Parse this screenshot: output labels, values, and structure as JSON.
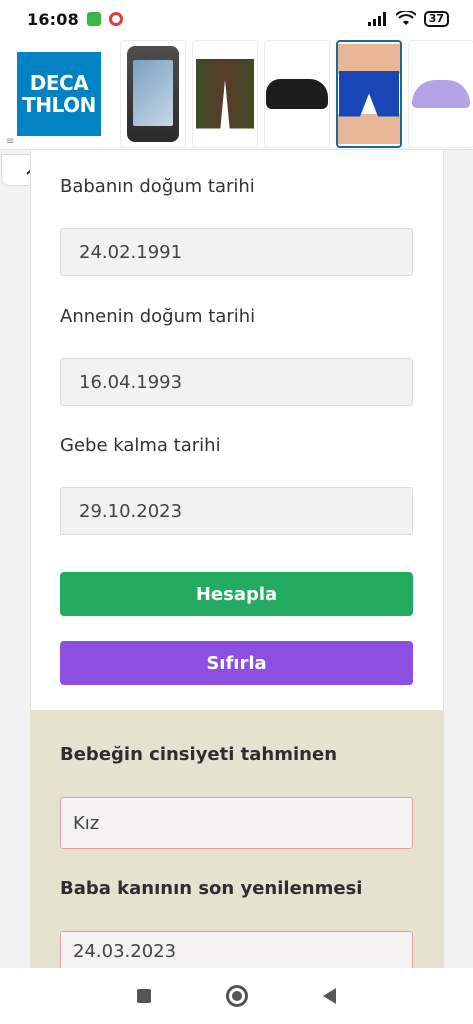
{
  "status_bar": {
    "time": "16:08",
    "battery": "37"
  },
  "ad": {
    "brand_line1": "DECA",
    "brand_line2": "THLON",
    "products": [
      "phone-pouch",
      "shorts",
      "water-shoe",
      "swim-trunks",
      "cap"
    ]
  },
  "form": {
    "father_label": "Babanın doğum tarihi",
    "father_value": "24.02.1991",
    "mother_label": "Annenin doğum tarihi",
    "mother_value": "16.04.1993",
    "conception_label": "Gebe kalma tarihi",
    "conception_value": "29.10.2023",
    "calculate_label": "Hesapla",
    "reset_label": "Sıfırla"
  },
  "result": {
    "gender_label": "Bebeğin cinsiyeti tahminen",
    "gender_value": "Kız",
    "father_renewal_label": "Baba kanının son yenilenmesi",
    "father_renewal_value": "24.03.2023"
  },
  "colors": {
    "calculate": "#24ab62",
    "reset": "#8c4fe0",
    "result_bg": "#e7e1cf",
    "brand": "#0082c3"
  }
}
